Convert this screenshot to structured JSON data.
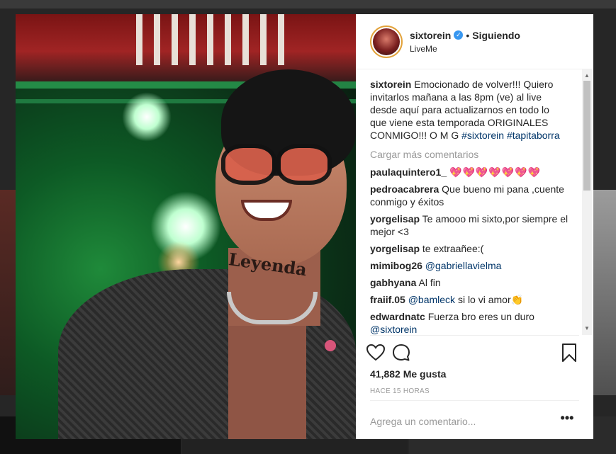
{
  "header": {
    "username": "sixtorein",
    "separator": "•",
    "follow_status": "Siguiendo",
    "location": "LiveMe"
  },
  "caption": {
    "username": "sixtorein",
    "text": "Emocionado de volver!!! Quiero invitarlos mañana a las 8pm (ve) al live desde aquí para actualizarnos en todo lo que viene esta temporada ORIGINALES CONMIGO!!! O M G",
    "hashtags": [
      "#sixtorein",
      "#tapitaborra"
    ]
  },
  "load_more": "Cargar más comentarios",
  "comments": [
    {
      "username": "paulaquintero1_",
      "text": "💖💖💖💖💖💖💖"
    },
    {
      "username": "pedroacabrera",
      "text": "Que bueno mi pana ,cuente conmigo y éxitos"
    },
    {
      "username": "yorgelisap",
      "text": "Te amooo mi sixto,por siempre el mejor <3"
    },
    {
      "username": "yorgelisap",
      "text": "te extraañee:("
    },
    {
      "username": "mimibog26",
      "mention": "@gabriellavielma",
      "text": ""
    },
    {
      "username": "gabhyana",
      "text": "Al fin"
    },
    {
      "username": "fraiif.05",
      "mention": "@bamleck",
      "text": "si lo vi amor👏"
    },
    {
      "username": "edwardnatc",
      "text": "Fuerza bro eres un duro",
      "mention_after": "@sixtorein"
    }
  ],
  "likes": {
    "count": "41,882",
    "label": "Me gusta"
  },
  "timestamp": "HACE 15 HORAS",
  "comment_box": {
    "placeholder": "Agrega un comentario...",
    "more": "•••"
  },
  "photo": {
    "tattoo_text": "Leyenda"
  },
  "colors": {
    "accent": "#3897f0",
    "text": "#262626",
    "muted": "#999999",
    "hashtag": "#003569",
    "hearts": "#d8284a"
  }
}
